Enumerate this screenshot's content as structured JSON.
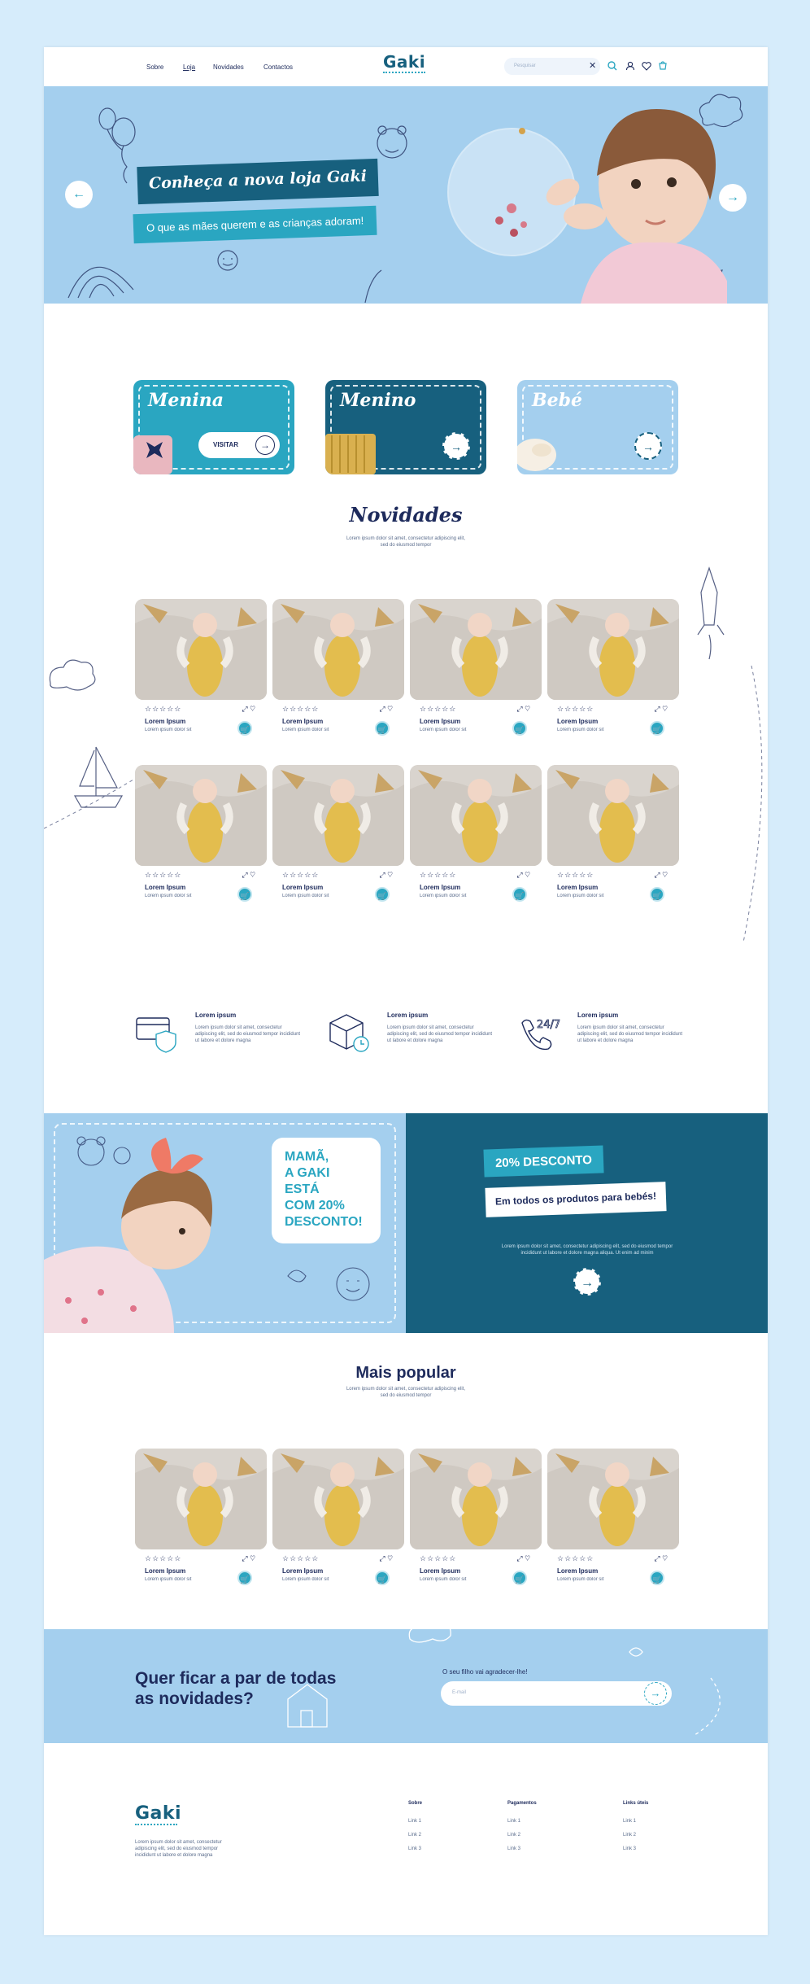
{
  "header": {
    "nav": [
      "Sobre",
      "Loja",
      "Novidades",
      "Contactos"
    ],
    "active_nav": "Loja",
    "logo": "Gaki",
    "search_placeholder": "Pesquisar"
  },
  "hero": {
    "title": "Conheça a nova loja Gaki",
    "subtitle": "O que as mães querem e as crianças adoram!"
  },
  "categories": [
    {
      "name": "Menina",
      "button": "VISITAR"
    },
    {
      "name": "Menino",
      "button": ""
    },
    {
      "name": "Bebé",
      "button": ""
    }
  ],
  "novidades": {
    "title": "Novidades",
    "subtitle": "Lorem ipsum dolor sit amet, consectetur adipiscing elit, sed do eiusmod tempor"
  },
  "product": {
    "name": "Lorem Ipsum",
    "desc": "Lorem ipsum dolor sit",
    "stars": "☆☆☆☆☆"
  },
  "features": [
    {
      "title": "Lorem ipsum",
      "desc": "Lorem ipsum dolor sit amet, consectetur adipiscing elit, sed do eiusmod tempor incididunt ut labore et dolore magna",
      "icon": "card-shield-icon"
    },
    {
      "title": "Lorem ipsum",
      "desc": "Lorem ipsum dolor sit amet, consectetur adipiscing elit, sed do eiusmod tempor incididunt ut labore et dolore magna",
      "icon": "box-clock-icon"
    },
    {
      "title": "Lorem ipsum",
      "desc": "Lorem ipsum dolor sit amet, consectetur adipiscing elit, sed do eiusmod tempor incididunt ut labore et dolore magna",
      "icon": "phone-24-7-icon"
    }
  ],
  "promo": {
    "bubble_lines": [
      "MAMÃ,",
      "A GAKI ESTÁ",
      "COM 20%",
      "DESCONTO!"
    ],
    "discount": "20% DESCONTO",
    "discount_sub": "Em todos os produtos para bebés!",
    "desc": "Lorem ipsum dolor sit amet, consectetur adipiscing elit, sed do eiusmod tempor incididunt ut labore et dolore magna aliqua. Ut enim ad minim"
  },
  "popular": {
    "title": "Mais popular",
    "subtitle": "Lorem ipsum dolor sit amet, consectetur adipiscing elit, sed do eiusmod tempor"
  },
  "newsletter": {
    "title": "Quer ficar a par de todas as novidades?",
    "label": "O seu filho vai agradecer-lhe!",
    "placeholder": "E-mail"
  },
  "footer": {
    "logo": "Gaki",
    "desc": "Lorem ipsum dolor sit amet, consectetur adipiscing elit, sed do eiusmod tempor incididunt ut labore et dolore magna",
    "columns": [
      {
        "title": "Sobre",
        "links": [
          "Link 1",
          "Link 2",
          "Link 3"
        ]
      },
      {
        "title": "Pagamentos",
        "links": [
          "Link 1",
          "Link 2",
          "Link 3"
        ]
      },
      {
        "title": "Links úteis",
        "links": [
          "Link 1",
          "Link 2",
          "Link 3"
        ]
      }
    ]
  },
  "colors": {
    "teal": "#2aa6c1",
    "navy": "#1e2b5c",
    "dark_teal": "#17607e",
    "light_blue": "#a4cfee"
  }
}
